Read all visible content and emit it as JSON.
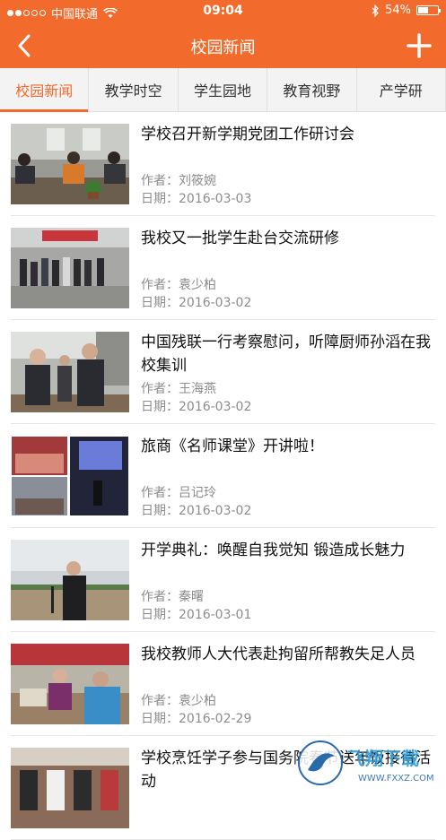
{
  "status": {
    "carrier": "中国联通",
    "time": "09:04",
    "battery": "54%",
    "battery_level": 0.54
  },
  "nav": {
    "title": "校园新闻"
  },
  "tabs": [
    {
      "label": "校园新闻",
      "active": true
    },
    {
      "label": "教学时空"
    },
    {
      "label": "学生园地"
    },
    {
      "label": "教育视野"
    },
    {
      "label": "产学研"
    }
  ],
  "author_prefix": "作者：",
  "date_prefix": "日期：",
  "news": [
    {
      "title": "学校召开新学期党团工作研讨会",
      "author": "刘筱婉",
      "date": "2016-03-03"
    },
    {
      "title": "我校又一批学生赴台交流研修",
      "author": "袁少柏",
      "date": "2016-03-02"
    },
    {
      "title": "中国残联一行考察慰问，听障厨师孙滔在我校集训",
      "author": "王海燕",
      "date": "2016-03-02"
    },
    {
      "title": "旅商《名师课堂》开讲啦！",
      "author": "吕记玲",
      "date": "2016-03-02"
    },
    {
      "title": "开学典礼：唤醒自我觉知 锻造成长魅力",
      "author": "秦曙",
      "date": "2016-03-01"
    },
    {
      "title": "我校教师人大代表赴拘留所帮教失足人员",
      "author": "袁少柏",
      "date": "2016-02-29"
    },
    {
      "title": "学校烹饪学子参与国务院春节送年饭接待活动",
      "author": "",
      "date": ""
    }
  ],
  "watermark": {
    "text": "飞翔下载",
    "url": "WWW.FXXZ.COM"
  },
  "colors": {
    "accent": "#f26a2c"
  }
}
